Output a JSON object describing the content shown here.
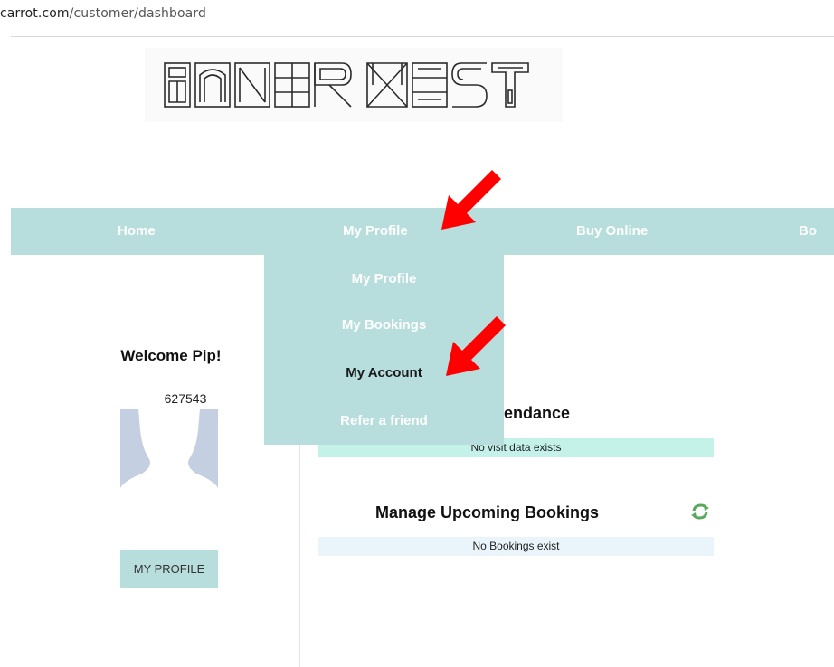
{
  "browser": {
    "url_host": "carrot.com",
    "url_path": "/customer/dashboard"
  },
  "brand": {
    "logo_text": "INNER WEST",
    "nav_color": "#b7dedd",
    "annotation_color": "#ff0000"
  },
  "nav": {
    "items": [
      {
        "label": "Home"
      },
      {
        "label": "My Profile"
      },
      {
        "label": "Buy Online"
      },
      {
        "label": "Bo"
      }
    ]
  },
  "dropdown": {
    "items": [
      {
        "label": "My Profile"
      },
      {
        "label": "My Bookings"
      },
      {
        "label": "My Account",
        "highlighted": true
      },
      {
        "label": "Refer a friend"
      }
    ]
  },
  "profile": {
    "welcome": "Welcome Pip!",
    "member_id": "627543",
    "button_label": "MY PROFILE"
  },
  "attendance": {
    "title": "Attendance",
    "empty_text": "No visit data exists"
  },
  "bookings": {
    "title": "Manage Upcoming Bookings",
    "empty_text": "No Bookings exist",
    "refresh_icon": "refresh-icon"
  }
}
